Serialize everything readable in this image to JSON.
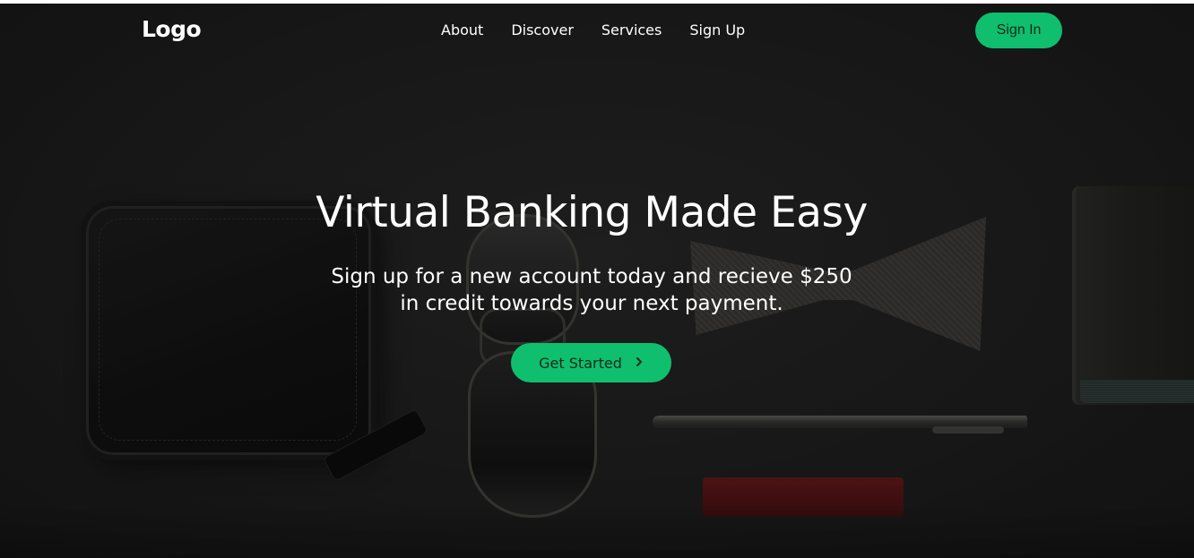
{
  "header": {
    "logo": "Logo",
    "nav": [
      {
        "label": "About"
      },
      {
        "label": "Discover"
      },
      {
        "label": "Services"
      },
      {
        "label": "Sign Up"
      }
    ],
    "sign_in_label": "Sign In"
  },
  "hero": {
    "title": "Virtual Banking Made Easy",
    "subtitle_line1": "Sign up for a new account today and recieve $250",
    "subtitle_line2": "in credit towards your next payment.",
    "cta_label": "Get Started",
    "cta_icon": "chevron-right-icon"
  },
  "colors": {
    "accent": "#0fbf6e",
    "background": "#222222",
    "text": "#ffffff"
  }
}
